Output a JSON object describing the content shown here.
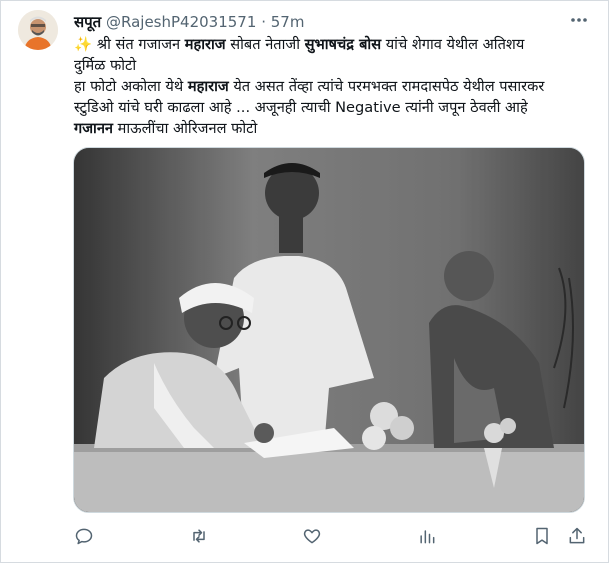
{
  "tweet": {
    "author_name": "सपूत",
    "handle": "@RajeshP42031571",
    "separator": "·",
    "time": "57m",
    "text_lines": [
      {
        "parts": [
          {
            "t": "✨ श्री संत गजाजन ",
            "b": false
          },
          {
            "t": "महाराज",
            "b": true
          },
          {
            "t": " सोबत नेताजी ",
            "b": false
          },
          {
            "t": "सुभाषचंद्र बोस",
            "b": true
          },
          {
            "t": " यांचे शेगाव येथील अतिशय",
            "b": false
          }
        ]
      },
      {
        "parts": [
          {
            "t": "दुर्मिळ फोटो",
            "b": false
          }
        ]
      },
      {
        "parts": [
          {
            "t": "हा फोटो अकोला येथे ",
            "b": false
          },
          {
            "t": "महाराज",
            "b": true
          },
          {
            "t": " येत असत तेंव्हा त्यांचे परमभक्त रामदासपेठ येथील पसारकर",
            "b": false
          }
        ]
      },
      {
        "parts": [
          {
            "t": "स्टुडिओ यांचे घरी काढला आहे ... अजूनही त्याची Negative त्यांनी जपून ठेवली आहे",
            "b": false
          }
        ]
      },
      {
        "parts": [
          {
            "t": " गजानन",
            "b": true
          },
          {
            "t": " माऊलींचा ओरिजनल फोटो",
            "b": false
          }
        ]
      }
    ]
  },
  "icons": {
    "more": "more-horizontal-icon",
    "reply": "reply-icon",
    "retweet": "retweet-icon",
    "like": "like-icon",
    "views": "views-icon",
    "bookmark": "bookmark-icon",
    "share": "share-icon"
  },
  "colors": {
    "text": "#0f1419",
    "muted": "#536471",
    "border": "#cfd9de"
  }
}
